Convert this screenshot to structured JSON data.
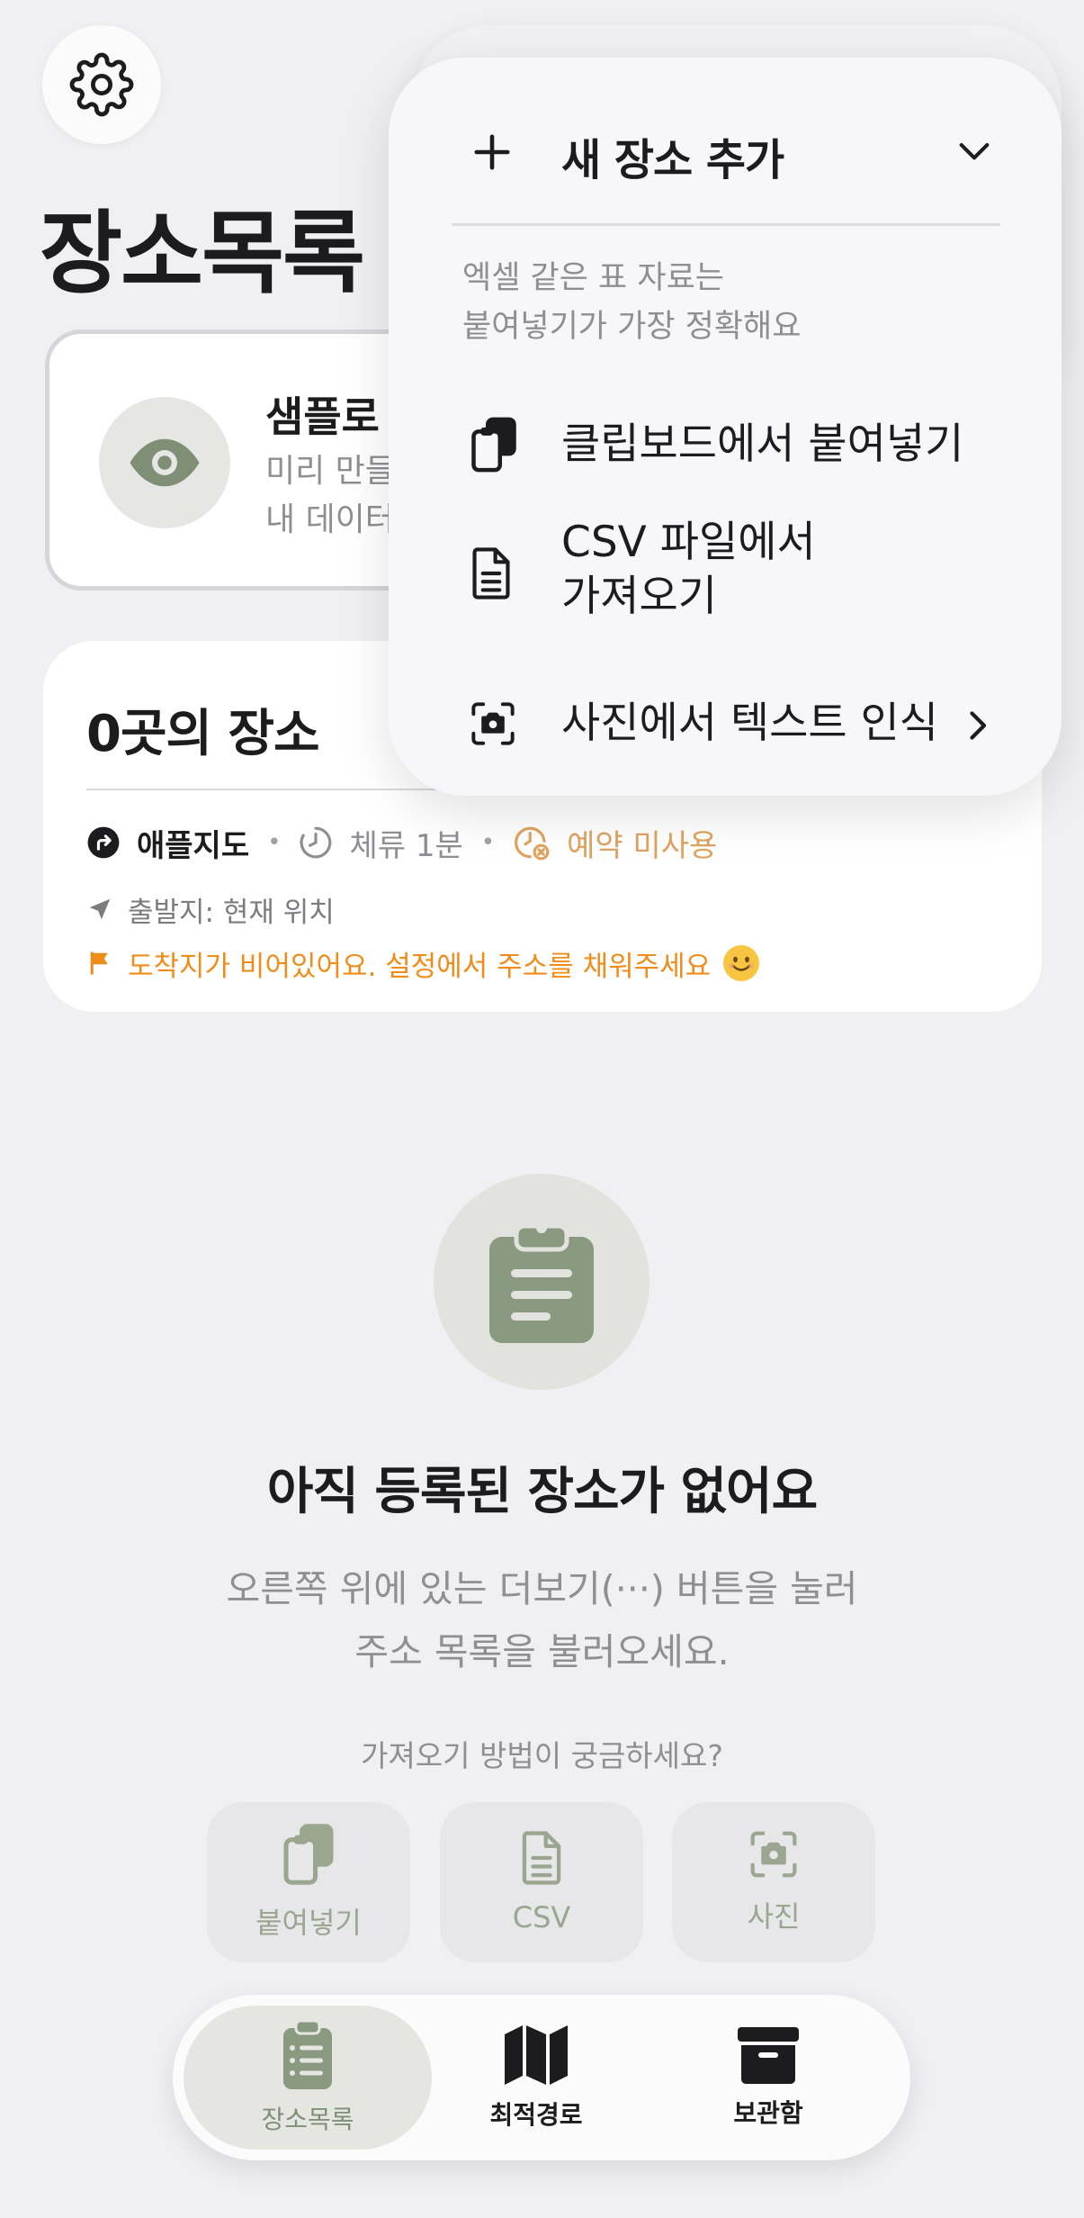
{
  "header": {
    "title": "장소목록"
  },
  "sample_card": {
    "title": "샘플로",
    "desc_line1": "미리 만들",
    "desc_line2": "내 데이터"
  },
  "summary": {
    "count_title": "0곳의 장소",
    "map_app": "애플지도",
    "stay_time": "체류 1분",
    "reservation": "예약 미사용",
    "origin": "출발지: 현재 위치",
    "warning": "도착지가 비어있어요. 설정에서 주소를 채워주세요"
  },
  "empty_state": {
    "title": "아직 등록된 장소가 없어요",
    "desc_line1": "오른쪽 위에 있는 더보기(···) 버튼을 눌러",
    "desc_line2": "주소 목록을 불러오세요.",
    "help_question": "가져오기 방법이 궁금하세요?"
  },
  "method_buttons": [
    {
      "label": "붙여넣기",
      "icon": "clipboard-paste-icon"
    },
    {
      "label": "CSV",
      "icon": "document-icon"
    },
    {
      "label": "사진",
      "icon": "camera-scan-icon"
    }
  ],
  "tabbar": {
    "tabs": [
      {
        "label": "장소목록",
        "icon": "clipboard-list-icon",
        "active": true
      },
      {
        "label": "최적경로",
        "icon": "map-icon",
        "active": false
      },
      {
        "label": "보관함",
        "icon": "archive-box-icon",
        "active": false
      }
    ]
  },
  "menu": {
    "add_label": "새 장소 추가",
    "hint_line1": "엑셀 같은 표 자료는",
    "hint_line2": "붙여넣기가 가장 정확해요",
    "items": [
      {
        "label": "클립보드에서 붙여넣기",
        "icon": "clipboard-paste-icon"
      },
      {
        "label_line1": "CSV 파일에서",
        "label_line2": "가져오기",
        "icon": "document-icon"
      },
      {
        "label": "사진에서 텍스트 인식",
        "icon": "camera-scan-icon"
      }
    ]
  },
  "colors": {
    "accent_green": "#7f8f76",
    "warning_orange": "#f08c1a",
    "reservation_orange": "#e0a360",
    "background": "#f0f0f3"
  }
}
